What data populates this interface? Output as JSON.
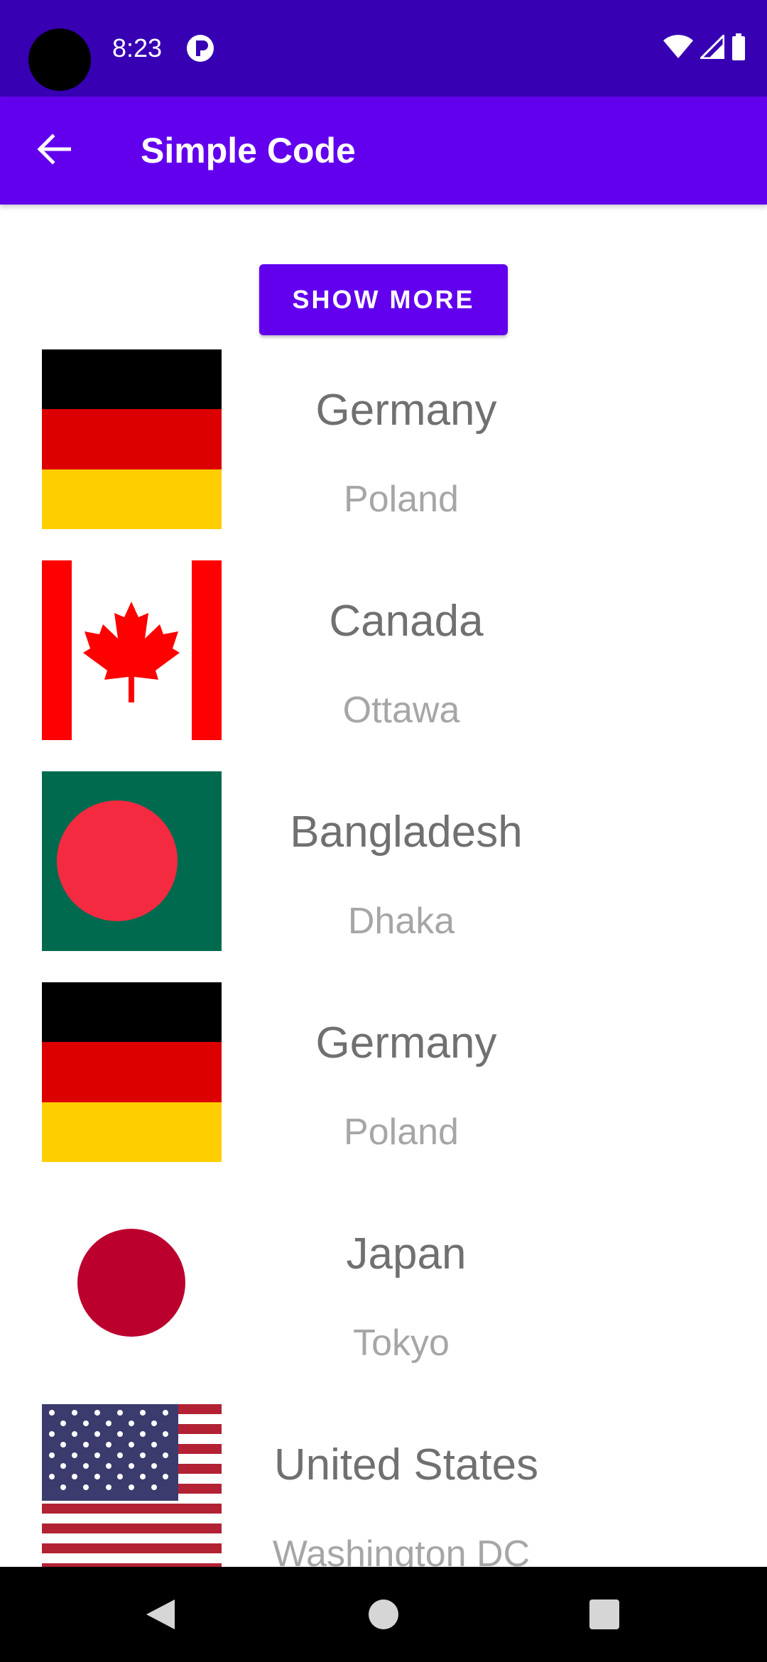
{
  "status_bar": {
    "time": "8:23",
    "background": "#3700b3",
    "icons": [
      "app-notification-icon",
      "wifi-icon",
      "signal-icon",
      "battery-icon"
    ]
  },
  "app_bar": {
    "title": "Simple Code",
    "background": "#6200ee",
    "back_icon": "arrow-back-icon"
  },
  "actions": {
    "show_more_label": "SHOW MORE"
  },
  "countries": [
    {
      "name": "Germany",
      "capital": "Poland",
      "flag_icon": "germany-flag"
    },
    {
      "name": "Canada",
      "capital": "Ottawa",
      "flag_icon": "canada-flag"
    },
    {
      "name": "Bangladesh",
      "capital": "Dhaka",
      "flag_icon": "bangladesh-flag"
    },
    {
      "name": "Germany",
      "capital": "Poland",
      "flag_icon": "germany-flag"
    },
    {
      "name": "Japan",
      "capital": "Tokyo",
      "flag_icon": "japan-flag"
    },
    {
      "name": "United States",
      "capital": "Washington DC",
      "flag_icon": "usa-flag"
    }
  ],
  "nav_bar": {
    "icons": [
      "nav-back-icon",
      "nav-home-icon",
      "nav-recents-icon"
    ]
  },
  "colors": {
    "primary": "#6200ee",
    "primary_dark": "#3700b3",
    "country_text": "#707070",
    "capital_text": "#a6a6a6"
  }
}
